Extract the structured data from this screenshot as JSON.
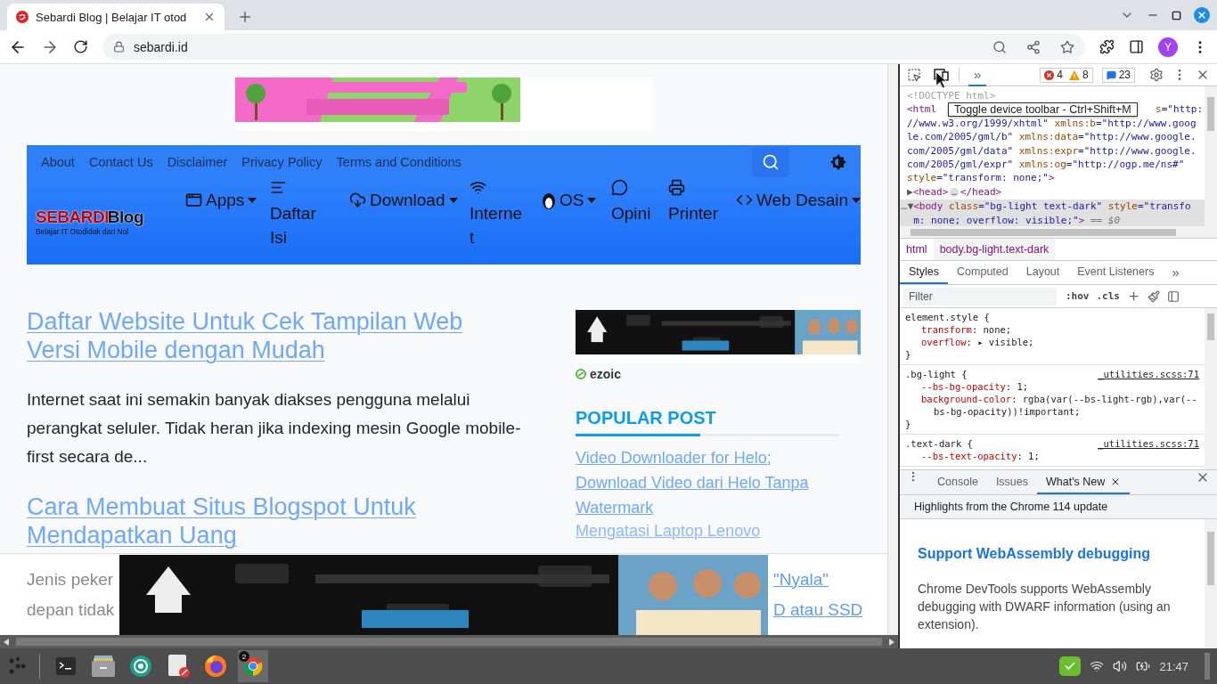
{
  "browser": {
    "tabs": [
      {
        "title": "Sebardi Blog | Belajar IT otod",
        "selected": true
      }
    ],
    "url": "sebardi.id",
    "avatar": "Y"
  },
  "page": {
    "nav_links": [
      "About",
      "Contact Us",
      "Disclaimer",
      "Privacy Policy",
      "Terms and Conditions"
    ],
    "logo": {
      "brand": "SEBARDI",
      "suffix": "Blog",
      "tagline": "Belajar IT Otodidak dari Nol"
    },
    "menu": [
      {
        "label": "Apps",
        "kind": "dropdown"
      },
      {
        "label": "Daftar Isi",
        "kind": "link"
      },
      {
        "label": "Download",
        "kind": "dropdown"
      },
      {
        "label": "Internet",
        "kind": "link"
      },
      {
        "label": "OS",
        "kind": "dropdown"
      },
      {
        "label": "Opini",
        "kind": "link"
      },
      {
        "label": "Printer",
        "kind": "link"
      },
      {
        "label": "Web Desain",
        "kind": "dropdown"
      }
    ],
    "articles": [
      {
        "title": "Daftar Website Untuk Cek Tampilan Web Versi Mobile dengan Mudah",
        "excerpt": "Internet saat ini semakin banyak diakses pengguna melalui perangkat seluler. Tidak heran jika indexing mesin Google mobile-first secara de..."
      },
      {
        "title": "Cara Membuat Situs Blogspot Untuk Mendapatkan Uang"
      }
    ],
    "ad_label": "ezoic",
    "sidebar": {
      "heading": "POPULAR POST",
      "posts": [
        {
          "title": "Video Downloader for Helo; Download Video dari Helo Tanpa Watermark"
        },
        {
          "title": "Mengatasi Laptop Lenovo"
        }
      ]
    },
    "sticky_ad": {
      "left_fragments": [
        "Jenis peker",
        "depan tidak"
      ],
      "right_fragments": [
        "\"Nyala\"",
        "D atau SSD"
      ]
    }
  },
  "devtools": {
    "more_panels": {
      "label": "»",
      "selected": true
    },
    "errors": "4",
    "warnings": "8",
    "messages": "23",
    "tooltip": "Toggle device toolbar - Ctrl+Shift+M",
    "code_lines": [
      {
        "selected": false,
        "left": [
          {
            "kind": "comment",
            "text": "<!DOCTYPE html>"
          }
        ]
      },
      {
        "selected": false,
        "left": [
          {
            "kind": "tag",
            "text": "<html"
          }
        ],
        "right": [
          {
            "kind": "attr",
            "text": "s"
          },
          {
            "kind": "value",
            "text": "=\"http:"
          }
        ]
      },
      {
        "selected": false,
        "left": [
          {
            "kind": "value",
            "text": "//www.w3.org/1999/xhtml\""
          },
          {
            "kind": "attr",
            "text": " xmlns:b"
          },
          {
            "kind": "value",
            "text": "=\"http://www.goog"
          }
        ]
      },
      {
        "selected": false,
        "left": [
          {
            "kind": "value",
            "text": "le.com/2005/gml/b\""
          },
          {
            "kind": "attr",
            "text": " xmlns:data"
          },
          {
            "kind": "value",
            "text": "=\"http://www.google."
          }
        ]
      },
      {
        "selected": false,
        "left": [
          {
            "kind": "value",
            "text": "com/2005/gml/data\""
          },
          {
            "kind": "attr",
            "text": " xmlns:expr"
          },
          {
            "kind": "value",
            "text": "=\"http://www.google."
          }
        ]
      },
      {
        "selected": false,
        "left": [
          {
            "kind": "value",
            "text": "com/2005/gml/expr\""
          },
          {
            "kind": "attr",
            "text": " xmlns:og"
          },
          {
            "kind": "value",
            "text": "=\"http://ogp.me/ns#\""
          }
        ]
      },
      {
        "selected": false,
        "left": [
          {
            "kind": "attr",
            "text": "style"
          },
          {
            "kind": "value",
            "text": "=\"transform: none;\""
          },
          {
            "kind": "tag",
            "text": ">"
          }
        ]
      },
      {
        "selected": false,
        "left": [
          {
            "kind": "arrow",
            "text": "▶"
          },
          {
            "kind": "tag",
            "text": "<head>"
          },
          {
            "kind": "pill",
            "text": "…"
          },
          {
            "kind": "tag",
            "text": "</head>"
          }
        ]
      },
      {
        "selected": true,
        "left": [
          {
            "kind": "dim",
            "text": "…"
          },
          {
            "kind": "arrow",
            "text": "▼"
          },
          {
            "kind": "tag",
            "text": "<body"
          },
          {
            "kind": "attr",
            "text": " class"
          },
          {
            "kind": "value",
            "text": "=\"bg-light text-dark\""
          },
          {
            "kind": "attr",
            "text": " style"
          },
          {
            "kind": "value",
            "text": "=\"transfo"
          }
        ]
      },
      {
        "selected": true,
        "left": [
          {
            "kind": "value",
            "text": "  m: none; overflow: visible;\""
          },
          {
            "kind": "tag",
            "text": ">"
          },
          {
            "kind": "dim",
            "text": " == $0"
          }
        ]
      }
    ],
    "breadcrumbs": [
      {
        "text": "html",
        "selected": false
      },
      {
        "text": "body.bg-light.text-dark",
        "selected": true
      }
    ],
    "style_tabs": [
      {
        "label": "Styles",
        "selected": true
      },
      {
        "label": "Computed",
        "selected": false
      },
      {
        "label": "Layout",
        "selected": false
      },
      {
        "label": "Event Listeners",
        "selected": false
      }
    ],
    "style_tabs_more": "»",
    "filter": {
      "placeholder": "Filter"
    },
    "hov": ":hov",
    "cls": ".cls",
    "rules": [
      {
        "selector": "element.style {",
        "decls": [
          {
            "prop": "transform",
            "value": ": none;"
          },
          {
            "prop": "overflow",
            "value": ": ▸ visible;"
          }
        ],
        "close": "}"
      },
      {
        "selector": ".bg-light {",
        "source": "_utilities.scss:71",
        "decls": [
          {
            "prop": "--bs-bg-opacity",
            "value": ": 1;"
          },
          {
            "prop": "background-color",
            "value": ": rgba(var(--bs-light-rgb),var(--bs-bg-opacity))!important;"
          }
        ],
        "close": "}"
      },
      {
        "selector": ".text-dark {",
        "source": "_utilities.scss:71",
        "decls": [
          {
            "prop": "--bs-text-opacity",
            "value": ": 1;"
          }
        ]
      }
    ],
    "drawer_tabs": [
      {
        "label": "Console",
        "selected": false
      },
      {
        "label": "Issues",
        "selected": false
      },
      {
        "label": "What's New",
        "selected": true
      }
    ],
    "whats_new": {
      "header": "Highlights from the Chrome 114 update",
      "title": "Support WebAssembly debugging",
      "body": "Chrome DevTools supports WebAssembly debugging with DWARF information (using an extension)."
    }
  },
  "taskbar": {
    "apps": [
      {
        "selected": false
      },
      {
        "selected": false
      },
      {
        "selected": false
      },
      {
        "selected": false
      },
      {
        "selected": false
      },
      {
        "selected": true,
        "badge": "2"
      }
    ],
    "clock": "21:47"
  }
}
